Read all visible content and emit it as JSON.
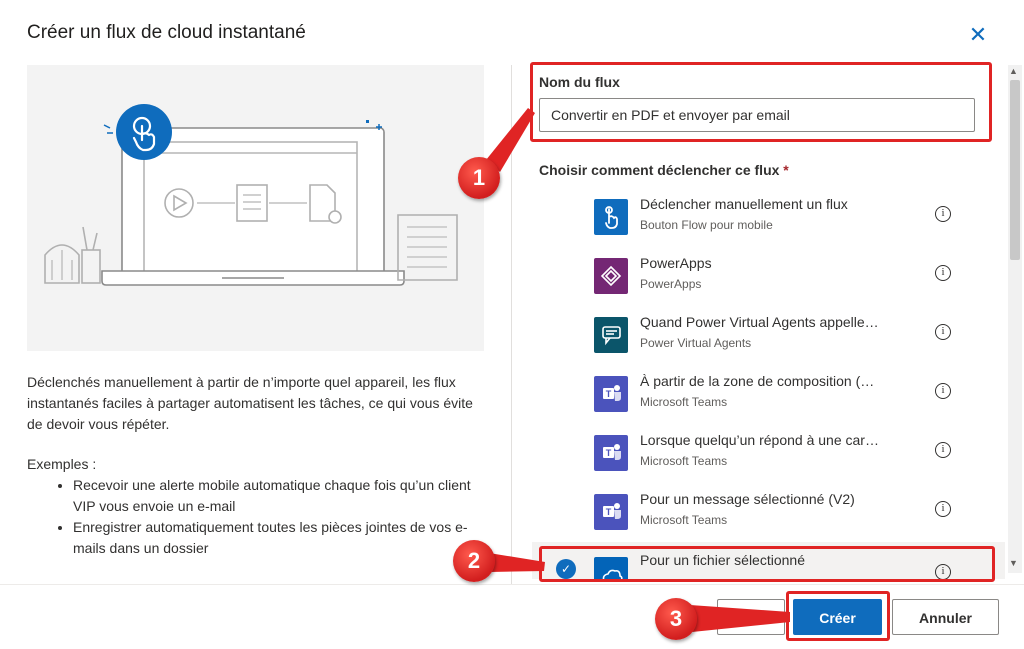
{
  "dialog": {
    "title": "Créer un flux de cloud instantané",
    "close_label": "✕"
  },
  "description": {
    "intro": "Déclenchés manuellement à partir de n’importe quel appareil, les flux instantanés faciles à partager automatisent les tâches, ce qui vous évite de devoir vous répéter.",
    "examples_heading": "Exemples :",
    "examples": [
      "Recevoir une alerte mobile automatique chaque fois qu’un client VIP vous envoie un e-mail",
      "Enregistrer automatiquement toutes les pièces jointes de vos e-mails dans un dossier"
    ]
  },
  "flow_name": {
    "label": "Nom du flux",
    "value": "Convertir en PDF et envoyer par email"
  },
  "trigger_section": {
    "label": "Choisir comment déclencher ce flux",
    "required_mark": "*"
  },
  "triggers": [
    {
      "name": "Déclencher manuellement un flux",
      "connector": "Bouton Flow pour mobile",
      "icon": "touch-button-icon",
      "color": "#0f6cbd",
      "selected": false
    },
    {
      "name": "PowerApps",
      "connector": "PowerApps",
      "icon": "powerapps-icon",
      "color": "#742774",
      "selected": false
    },
    {
      "name": "Quand Power Virtual Agents appelle…",
      "connector": "Power Virtual Agents",
      "icon": "chatbot-icon",
      "color": "#0b556a",
      "selected": false
    },
    {
      "name": "À partir de la zone de composition (…",
      "connector": "Microsoft Teams",
      "icon": "teams-icon",
      "color": "#4b53bc",
      "selected": false
    },
    {
      "name": "Lorsque quelqu’un répond à une car…",
      "connector": "Microsoft Teams",
      "icon": "teams-icon",
      "color": "#4b53bc",
      "selected": false
    },
    {
      "name": "Pour un message sélectionné (V2)",
      "connector": "Microsoft Teams",
      "icon": "teams-icon",
      "color": "#4b53bc",
      "selected": false
    },
    {
      "name": "Pour un fichier sélectionné",
      "connector": "",
      "icon": "onedrive-icon",
      "color": "#0364b8",
      "selected": true
    }
  ],
  "buttons": {
    "skip": "r",
    "create": "Créer",
    "cancel": "Annuler"
  },
  "callouts": [
    "1",
    "2",
    "3"
  ],
  "colors": {
    "accent": "#0f6cbd",
    "highlight": "#e02424"
  }
}
